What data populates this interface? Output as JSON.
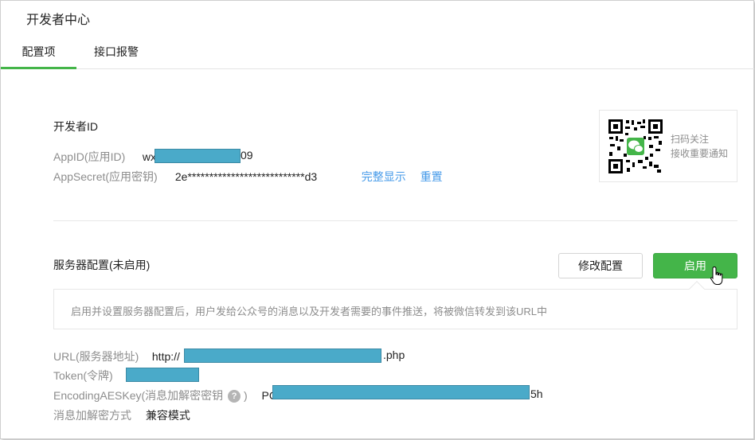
{
  "page": {
    "title": "开发者中心"
  },
  "tabs": [
    {
      "label": "配置项",
      "active": true
    },
    {
      "label": "接口报警",
      "active": false
    }
  ],
  "developer_id": {
    "heading": "开发者ID",
    "appid_label": "AppID(应用ID)",
    "appid_prefix": "wx",
    "appid_suffix": "09",
    "appsecret_label": "AppSecret(应用密钥)",
    "appsecret_value": "2e***************************d3",
    "show_full_link": "完整显示",
    "reset_link": "重置"
  },
  "qr": {
    "line1": "扫码关注",
    "line2": "接收重要通知"
  },
  "server": {
    "heading": "服务器配置(未启用)",
    "modify_button": "修改配置",
    "enable_button": "启用",
    "tip": "启用并设置服务器配置后，用户发给公众号的消息以及开发者需要的事件推送，将被微信转发到该URL中",
    "url_label": "URL(服务器地址)",
    "url_prefix": "http://",
    "url_suffix": ".php",
    "token_label": "Token(令牌)",
    "aeskey_label": "EncodingAESKey(消息加解密密钥",
    "aeskey_label_end": ")",
    "aeskey_prefix": "PC",
    "aeskey_suffix": "5h",
    "encrypt_label": "消息加解密方式",
    "encrypt_value": "兼容模式"
  },
  "colors": {
    "accent_green": "#44b549",
    "link_blue": "#459ae9",
    "redaction": "#4aaac9",
    "muted_text": "#8d8d8d"
  },
  "icons": {
    "help": "question-circle-icon",
    "cursor": "hand-pointer-icon",
    "qr": "qr-code-icon"
  }
}
